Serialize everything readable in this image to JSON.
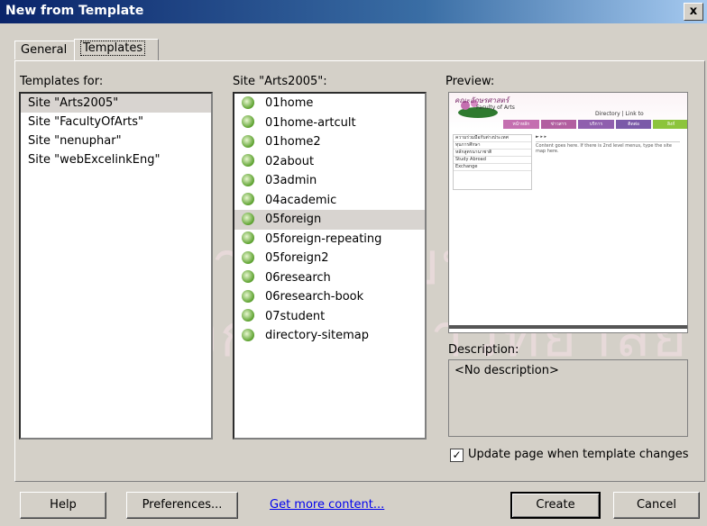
{
  "window": {
    "title": "New from Template",
    "close_glyph": "x"
  },
  "watermark": [
    "สถาบันวิทยบริการ",
    "จุฬาลงกรณ์มหาวิทยาลัย"
  ],
  "tabs": [
    {
      "label": "General"
    },
    {
      "label": "Templates"
    }
  ],
  "templates_for": {
    "label": "Templates for:",
    "items": [
      "Site \"Arts2005\"",
      "Site \"FacultyOfArts\"",
      "Site \"nenuphar\"",
      "Site \"webExcelinkEng\""
    ],
    "selected_index": 0
  },
  "site_list": {
    "label": "Site \"Arts2005\":",
    "items": [
      "01home",
      "01home-artcult",
      "01home2",
      "02about",
      "03admin",
      "04academic",
      "05foreign",
      "05foreign-repeating",
      "05foreign2",
      "06research",
      "06research-book",
      "07student",
      "directory-sitemap"
    ],
    "selected_index": 6,
    "icon": "template-file-icon"
  },
  "preview": {
    "label": "Preview:",
    "logo_text": "คณะอักษรศาสตร์",
    "logo_sub": "Faculty of Arts",
    "directory_text": "Directory | Link to",
    "nav_items": [
      "หน้าหลัก",
      "ข่าวสาร",
      "บริการ",
      "ติดต่อ",
      "ลิงก์"
    ],
    "side_links": [
      "ความร่วมมือกับต่างประเทศ",
      "ทุนการศึกษา",
      "หลักสูตรนานาชาติ",
      "Study Abroad",
      "Exchange"
    ],
    "content_text": "Content goes here. If there is 2nd level menus, type the site map here."
  },
  "description": {
    "label": "Description:",
    "value": "<No description>"
  },
  "update_checkbox": {
    "checked": true,
    "mark": "✓",
    "label": "Update page when template changes"
  },
  "buttons": {
    "help": "Help",
    "preferences": "Preferences...",
    "create": "Create",
    "cancel": "Cancel"
  },
  "link": {
    "get_more": "Get more content..."
  },
  "colors": {
    "title_start": "#0a246a",
    "title_end": "#a6caf0",
    "face": "#d4d0c8",
    "link": "#0000ee"
  }
}
